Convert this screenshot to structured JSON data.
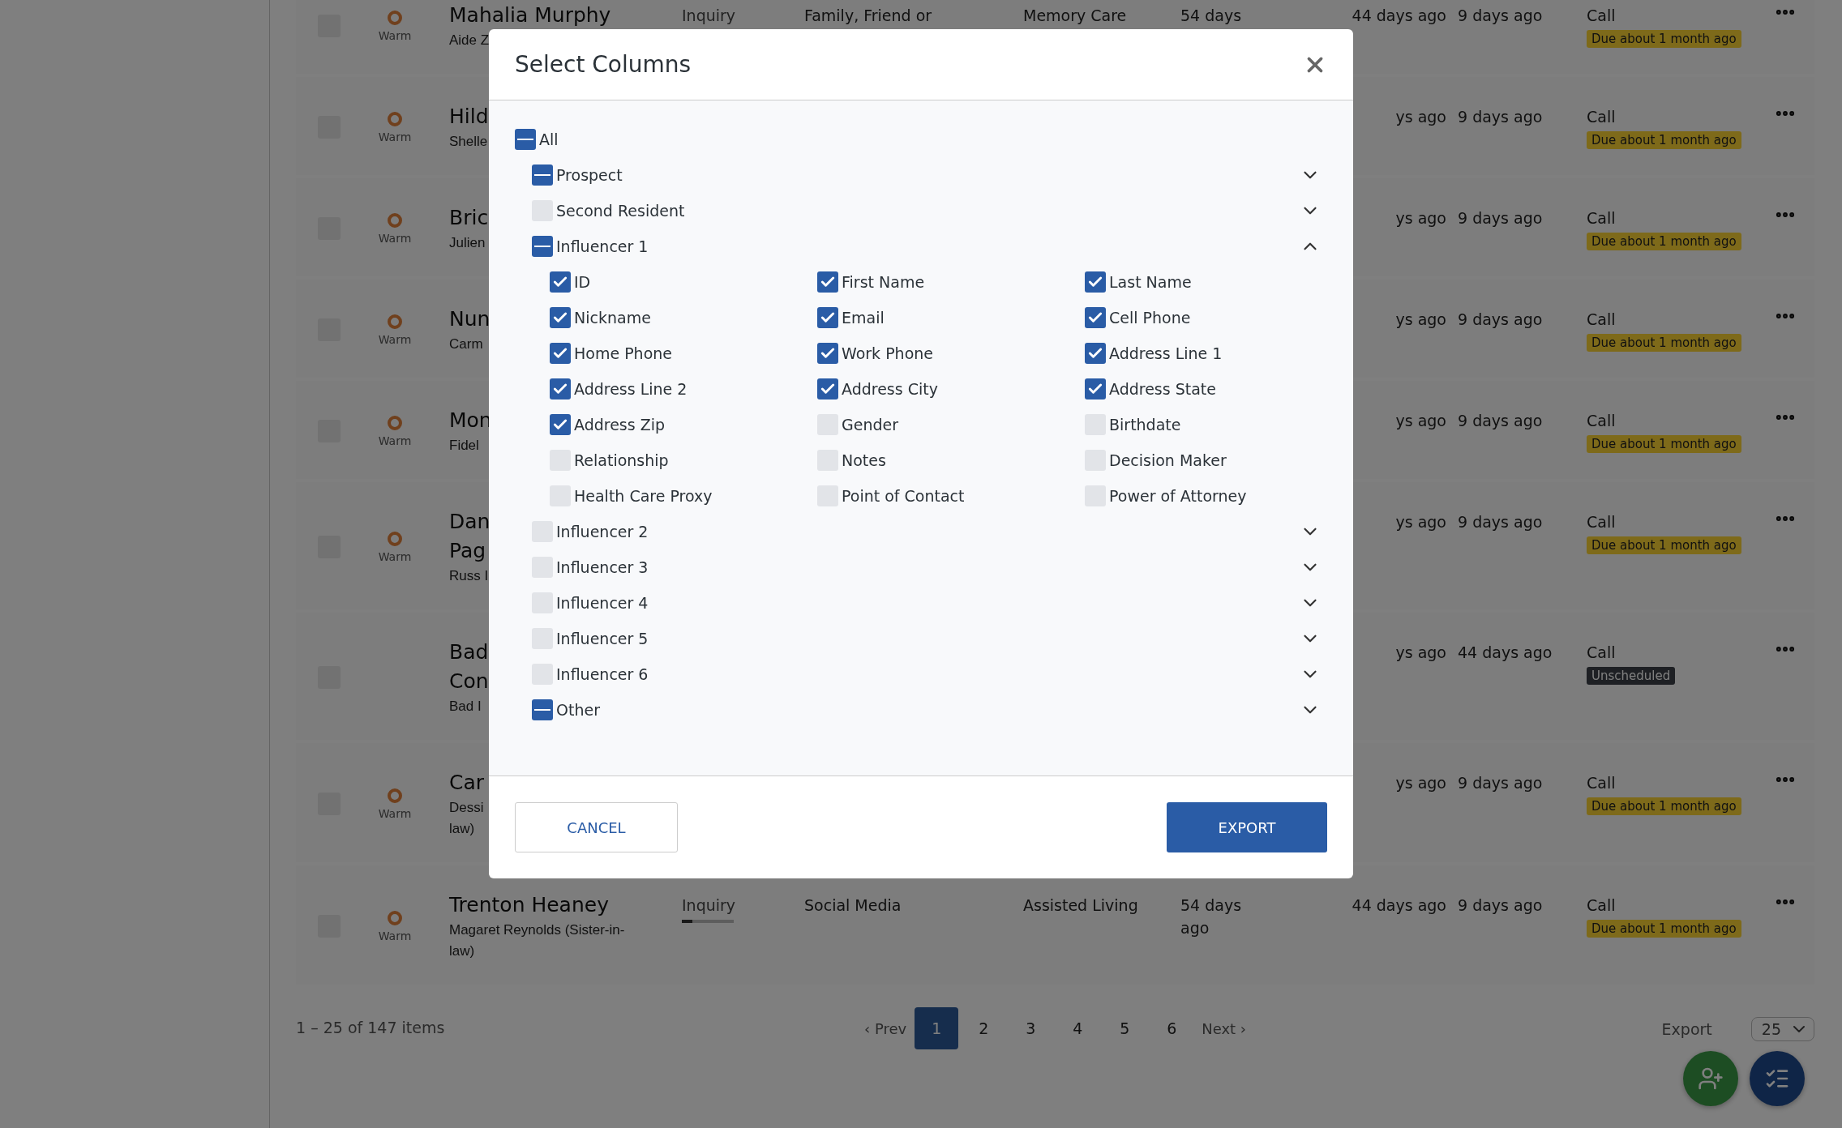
{
  "rows": [
    {
      "selected": false,
      "temperature": "Warm",
      "name": "Mahalia Murphy",
      "contact": "Aide Z",
      "column_3": "Inquiry",
      "column_4": "Family, Friend or",
      "column_5": "Memory Care",
      "column_6": "54 days",
      "column_7": "44 days ago",
      "column_8": "9 days ago",
      "task": "Call",
      "badge": {
        "text": "Due about 1 month ago",
        "kind": "due"
      }
    },
    {
      "selected": false,
      "temperature": "Warm",
      "name": "Hild",
      "contact": "Shelle",
      "column_7": "ys ago",
      "column_8": "9 days ago",
      "task": "Call",
      "badge": {
        "text": "Due about 1 month ago",
        "kind": "due"
      }
    },
    {
      "selected": false,
      "temperature": "Warm",
      "name": "Bric",
      "contact": "Julien",
      "column_7": "ys ago",
      "column_8": "9 days ago",
      "task": "Call",
      "badge": {
        "text": "Due about 1 month ago",
        "kind": "due"
      }
    },
    {
      "selected": false,
      "temperature": "Warm",
      "name": "Nun",
      "contact": "Carm",
      "column_7": "ys ago",
      "column_8": "9 days ago",
      "task": "Call",
      "badge": {
        "text": "Due about 1 month ago",
        "kind": "due"
      }
    },
    {
      "selected": false,
      "temperature": "Warm",
      "name": "Mon",
      "contact": "Fidel",
      "column_7": "ys ago",
      "column_8": "9 days ago",
      "task": "Call",
      "badge": {
        "text": "Due about 1 month ago",
        "kind": "due"
      }
    },
    {
      "selected": false,
      "temperature": "Warm",
      "name": "Dan\nPag",
      "contact": "Russ I",
      "column_7": "ys ago",
      "column_8": "9 days ago",
      "task": "Call",
      "badge": {
        "text": "Due about 1 month ago",
        "kind": "due"
      }
    },
    {
      "selected": false,
      "name": "Bad\nCon",
      "contact": "Bad I",
      "column_7": "ys ago",
      "column_8": "44 days ago",
      "task": "Call",
      "badge": {
        "text": "Unscheduled",
        "kind": "unscheduled"
      }
    },
    {
      "selected": false,
      "temperature": "Warm",
      "name": "Car",
      "contact": "Dessi\nlaw)",
      "column_7": "ys ago",
      "column_8": "9 days ago",
      "task": "Call",
      "badge": {
        "text": "Due about 1 month ago",
        "kind": "due"
      }
    },
    {
      "selected": false,
      "temperature": "Warm",
      "name": "Trenton Heaney",
      "contact": "Magaret Reynolds (Sister-in-\nlaw)",
      "column_3": "Inquiry",
      "level": 0.2,
      "column_4": "Social Media",
      "column_5": "Assisted Living",
      "column_6": "54 days\nago",
      "column_7": "44 days ago",
      "column_8": "9 days ago",
      "task": "Call",
      "badge": {
        "text": "Due about 1 month ago",
        "kind": "due"
      }
    }
  ],
  "footer": {
    "summary": "1 – 25 of 147 items",
    "prev": "‹ Prev",
    "next": "Next ›",
    "pages": [
      {
        "label": "1",
        "selected": true
      },
      {
        "label": "2",
        "selected": false
      },
      {
        "label": "3",
        "selected": false
      },
      {
        "label": "4",
        "selected": false
      },
      {
        "label": "5",
        "selected": false
      },
      {
        "label": "6",
        "selected": false
      }
    ],
    "export": "Export",
    "page_size": "25"
  },
  "dialog": {
    "title": "Select Columns",
    "tree": {
      "label": "All",
      "indeterminate": true,
      "children": [
        {
          "label": "Prospect",
          "indeterminate": true,
          "expanded": false
        },
        {
          "label": "Second Resident",
          "checked": false,
          "expanded": false
        },
        {
          "label": "Influencer 1",
          "indeterminate": true,
          "expanded": true,
          "children": [
            {
              "label": "ID",
              "checked": true
            },
            {
              "label": "First Name",
              "checked": true
            },
            {
              "label": "Last Name",
              "checked": true
            },
            {
              "label": "Nickname",
              "checked": true
            },
            {
              "label": "Email",
              "checked": true
            },
            {
              "label": "Cell Phone",
              "checked": true
            },
            {
              "label": "Home Phone",
              "checked": true
            },
            {
              "label": "Work Phone",
              "checked": true
            },
            {
              "label": "Address Line 1",
              "checked": true
            },
            {
              "label": "Address Line 2",
              "checked": true
            },
            {
              "label": "Address City",
              "checked": true
            },
            {
              "label": "Address State",
              "checked": true
            },
            {
              "label": "Address Zip",
              "checked": true
            },
            {
              "label": "Gender",
              "checked": false
            },
            {
              "label": "Birthdate",
              "checked": false
            },
            {
              "label": "Relationship",
              "checked": false
            },
            {
              "label": "Notes",
              "checked": false
            },
            {
              "label": "Decision Maker",
              "checked": false
            },
            {
              "label": "Health Care Proxy",
              "checked": false
            },
            {
              "label": "Point of Contact",
              "checked": false
            },
            {
              "label": "Power of Attorney",
              "checked": false
            }
          ]
        },
        {
          "label": "Influencer 2",
          "checked": false,
          "expanded": false
        },
        {
          "label": "Influencer 3",
          "checked": false,
          "expanded": false
        },
        {
          "label": "Influencer 4",
          "checked": false,
          "expanded": false
        },
        {
          "label": "Influencer 5",
          "checked": false,
          "expanded": false
        },
        {
          "label": "Influencer 6",
          "checked": false,
          "expanded": false
        },
        {
          "label": "Other",
          "indeterminate": true,
          "expanded": false
        }
      ]
    },
    "buttons": [
      {
        "label": "CANCEL",
        "kind": "secondary"
      },
      {
        "label": "EXPORT",
        "kind": "primary"
      }
    ]
  }
}
